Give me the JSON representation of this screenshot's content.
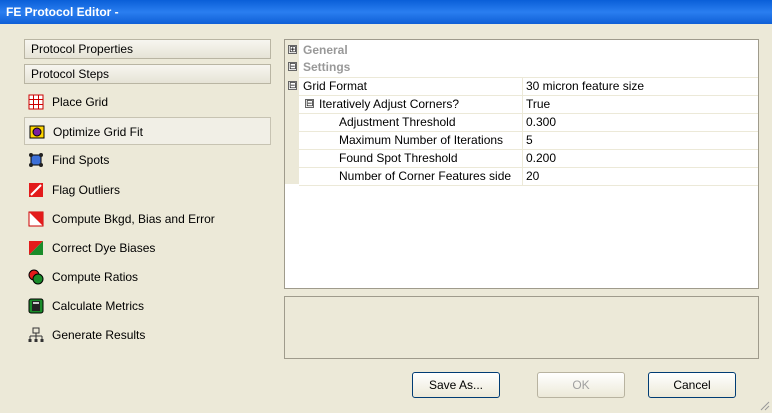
{
  "window": {
    "title": "FE Protocol Editor -"
  },
  "left_panel": {
    "headers": [
      "Protocol Properties",
      "Protocol Steps"
    ],
    "steps": [
      {
        "label": "Place Grid",
        "icon": "grid-icon",
        "selected": false
      },
      {
        "label": "Optimize Grid Fit",
        "icon": "optimize-icon",
        "selected": true
      },
      {
        "label": "Find Spots",
        "icon": "find-spots-icon",
        "selected": false
      },
      {
        "label": "Flag Outliers",
        "icon": "flag-icon",
        "selected": false
      },
      {
        "label": "Compute Bkgd, Bias and Error",
        "icon": "compute-bkgd-icon",
        "selected": false
      },
      {
        "label": "Correct Dye Biases",
        "icon": "dye-icon",
        "selected": false
      },
      {
        "label": "Compute Ratios",
        "icon": "ratios-icon",
        "selected": false
      },
      {
        "label": "Calculate Metrics",
        "icon": "calculator-icon",
        "selected": false
      },
      {
        "label": "Generate Results",
        "icon": "results-icon",
        "selected": false
      }
    ]
  },
  "property_grid": {
    "categories": [
      {
        "label": "General",
        "expander": "⊞"
      },
      {
        "label": "Settings",
        "expander": "⊟"
      }
    ],
    "rows": [
      {
        "name": "Grid Format",
        "value": "30 micron feature size",
        "expander": "⊟"
      },
      {
        "name": "Iteratively Adjust Corners?",
        "value": "True",
        "expander": "⊟"
      },
      {
        "name": "Adjustment Threshold",
        "value": "0.300"
      },
      {
        "name": "Maximum Number of Iterations",
        "value": "5"
      },
      {
        "name": "Found Spot Threshold",
        "value": "0.200"
      },
      {
        "name": "Number of Corner Features side",
        "value": "20"
      }
    ]
  },
  "buttons": {
    "save_as": "Save As...",
    "ok": "OK",
    "cancel": "Cancel"
  }
}
